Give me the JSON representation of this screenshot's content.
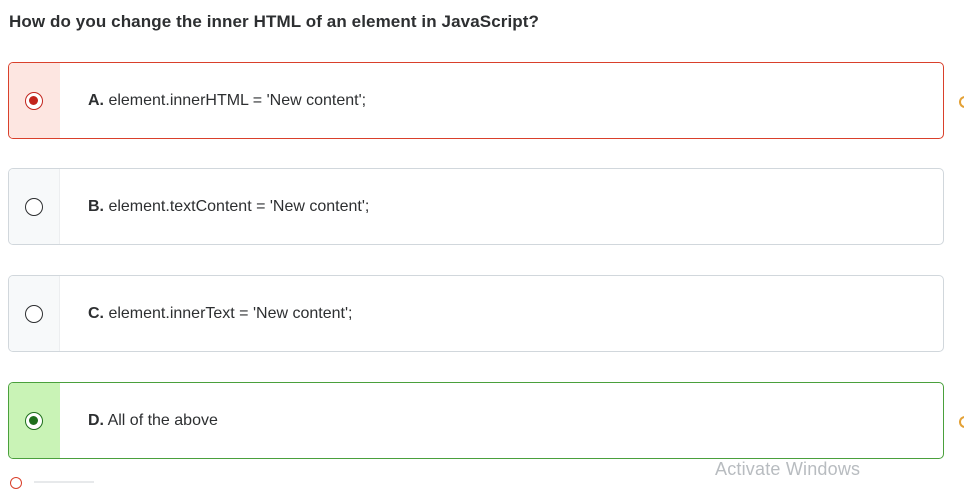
{
  "question": "How do you change the inner HTML of an element in JavaScript?",
  "options": [
    {
      "letter": "A.",
      "text": " element.innerHTML = 'New content';",
      "state": "selected-incorrect"
    },
    {
      "letter": "B.",
      "text": " element.textContent = 'New content';",
      "state": "unselected"
    },
    {
      "letter": "C.",
      "text": " element.innerText = 'New content';",
      "state": "unselected"
    },
    {
      "letter": "D.",
      "text": " All of the above",
      "state": "correct"
    }
  ],
  "watermark": "Activate Windows",
  "colors": {
    "incorrect_border": "#d9402b",
    "incorrect_fill": "#fde6e1",
    "correct_border": "#4aa03c",
    "correct_fill": "#c9f3b6",
    "text": "#2d2f31"
  }
}
